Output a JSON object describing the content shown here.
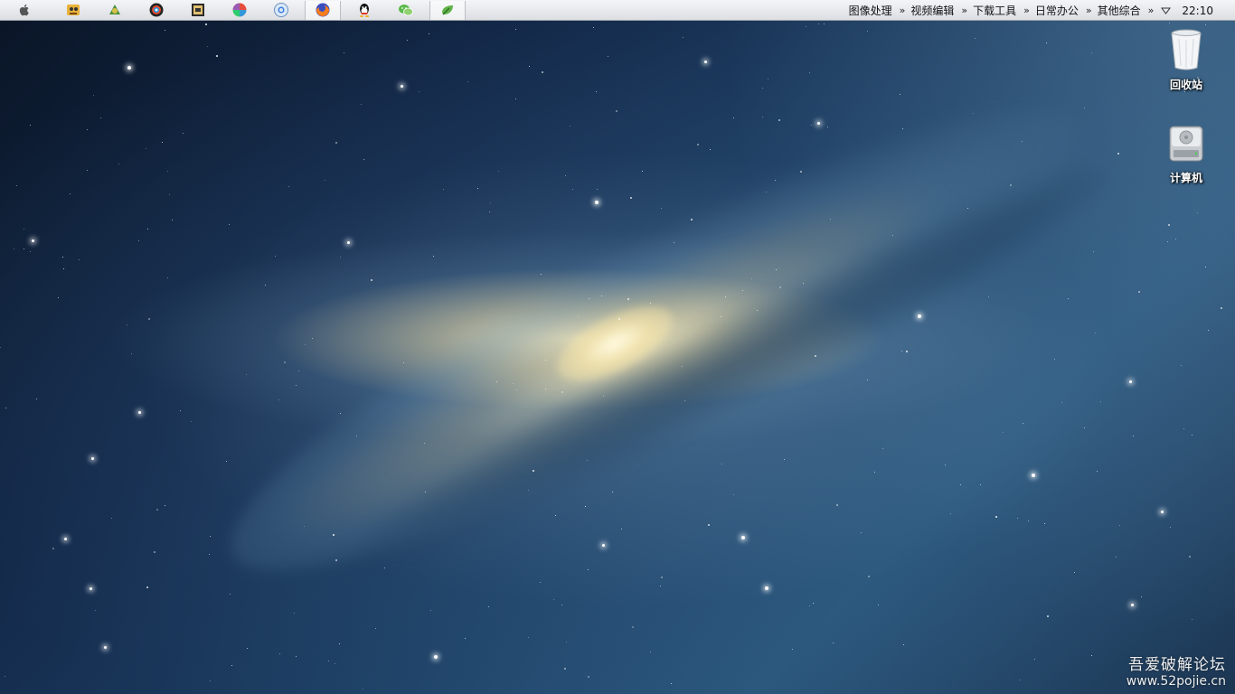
{
  "menubar": {
    "taskbar_icons": [
      {
        "name": "app-icon-1"
      },
      {
        "name": "app-icon-2"
      },
      {
        "name": "app-icon-3"
      },
      {
        "name": "app-icon-4"
      },
      {
        "name": "app-icon-5"
      },
      {
        "name": "chrome-icon"
      },
      {
        "name": "firefox-icon"
      },
      {
        "name": "qq-icon"
      },
      {
        "name": "wechat-icon"
      },
      {
        "name": "app-icon-10"
      }
    ],
    "menus": [
      {
        "label": "图像处理"
      },
      {
        "label": "视频编辑"
      },
      {
        "label": "下载工具"
      },
      {
        "label": "日常办公"
      },
      {
        "label": "其他综合"
      }
    ],
    "chevron": "»",
    "clock": "22:10"
  },
  "desktop": {
    "icons": [
      {
        "label": "回收站",
        "icon": "recycle-bin-icon"
      },
      {
        "label": "计算机",
        "icon": "computer-icon"
      }
    ]
  },
  "watermark": {
    "title": "吾爱破解论坛",
    "url": "www.52pojie.cn"
  }
}
